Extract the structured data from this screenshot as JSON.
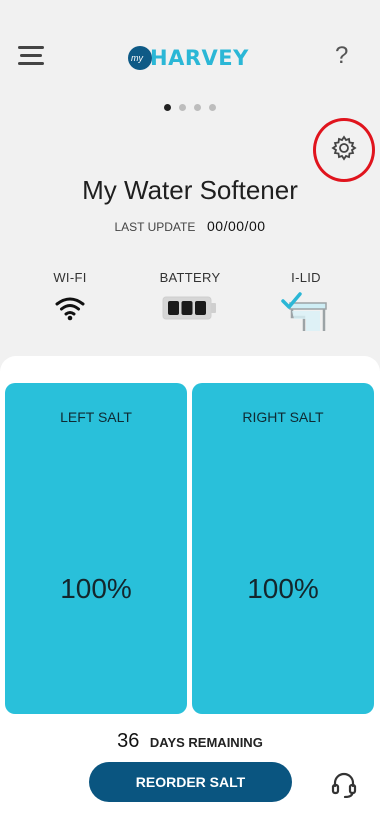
{
  "header": {
    "logo_prefix": "my",
    "logo_text": "HARVEY",
    "help_label": "?"
  },
  "pager": {
    "count": 4,
    "active": 1
  },
  "device": {
    "name": "My Water Softener",
    "last_update_label": "LAST UPDATE",
    "last_update_value": "00/00/00"
  },
  "status": {
    "wifi_label": "WI-FI",
    "battery_label": "BATTERY",
    "ilid_label": "I-LID"
  },
  "tanks": {
    "left_label": "LEFT SALT",
    "left_value": "100%",
    "right_label": "RIGHT SALT",
    "right_value": "100%"
  },
  "footer": {
    "days_value": "36",
    "days_label": "DAYS REMAINING",
    "reorder_label": "REORDER SALT"
  },
  "colors": {
    "brand_blue": "#0a5580",
    "tank_cyan": "#29c0da",
    "highlight_red": "#e0141d"
  }
}
